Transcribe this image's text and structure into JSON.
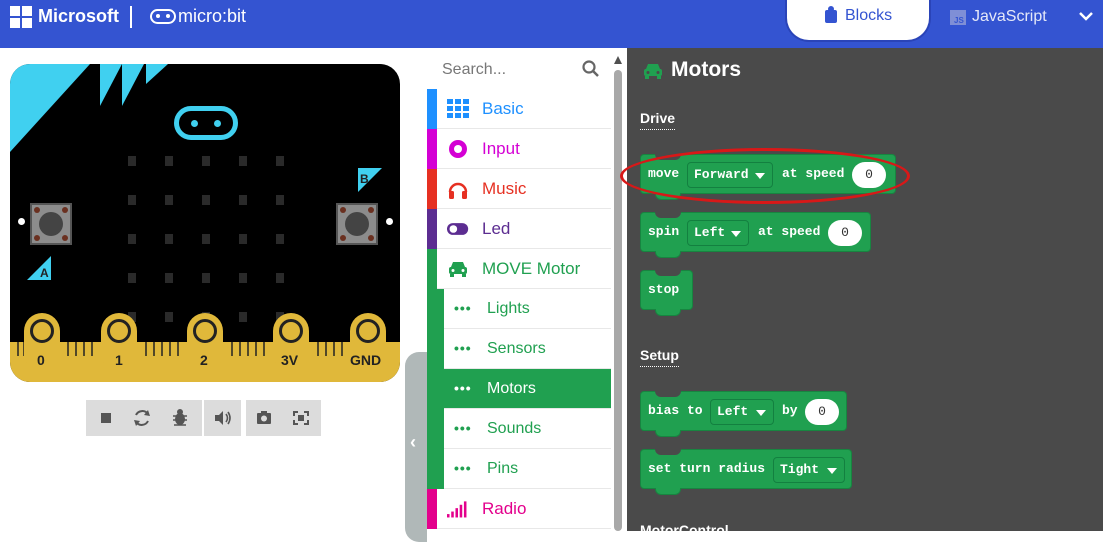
{
  "header": {
    "brand": "Microsoft",
    "product": "micro:bit",
    "tabs": [
      {
        "label": "Blocks",
        "active": true,
        "icon": "puzzle-icon"
      },
      {
        "label": "JavaScript",
        "active": false,
        "icon": "js-file-icon"
      }
    ],
    "js_icon_text": "JS",
    "accent_color": "#3454d1"
  },
  "simulator": {
    "button_a": "A",
    "button_b": "B",
    "pins": [
      "0",
      "1",
      "2",
      "3V",
      "GND"
    ],
    "toolbar": [
      "stop-icon",
      "restart-icon",
      "debug-icon",
      "sound-icon",
      "screenshot-icon",
      "fullscreen-icon"
    ]
  },
  "toolbox": {
    "search_placeholder": "Search...",
    "categories": [
      {
        "label": "Basic",
        "color": "#1e90ff"
      },
      {
        "label": "Input",
        "color": "#d400d4"
      },
      {
        "label": "Music",
        "color": "#e63022"
      },
      {
        "label": "Led",
        "color": "#5c2d91"
      },
      {
        "label": "MOVE Motor",
        "color": "#20a050"
      }
    ],
    "subcategories": [
      {
        "label": "Lights",
        "active": false
      },
      {
        "label": "Sensors",
        "active": false
      },
      {
        "label": "Motors",
        "active": true
      },
      {
        "label": "Sounds",
        "active": false
      },
      {
        "label": "Pins",
        "active": false
      }
    ],
    "radio": {
      "label": "Radio",
      "color": "#e3008c"
    },
    "subcategory_dots": "•••"
  },
  "flyout": {
    "title": "Motors",
    "sections": [
      {
        "label": "Drive"
      },
      {
        "label": "Setup"
      },
      {
        "label": "MotorControl"
      }
    ],
    "blocks": {
      "move": {
        "text": "move",
        "dropdown": "Forward",
        "text2": "at speed",
        "value": "0"
      },
      "spin": {
        "text": "spin",
        "dropdown": "Left",
        "text2": "at speed",
        "value": "0"
      },
      "stop": {
        "text": "stop"
      },
      "bias": {
        "text": "bias to",
        "dropdown": "Left",
        "text2": "by",
        "value": "0"
      },
      "turn": {
        "text": "set turn radius",
        "dropdown": "Tight"
      }
    },
    "annotation_color": "#d81818"
  }
}
